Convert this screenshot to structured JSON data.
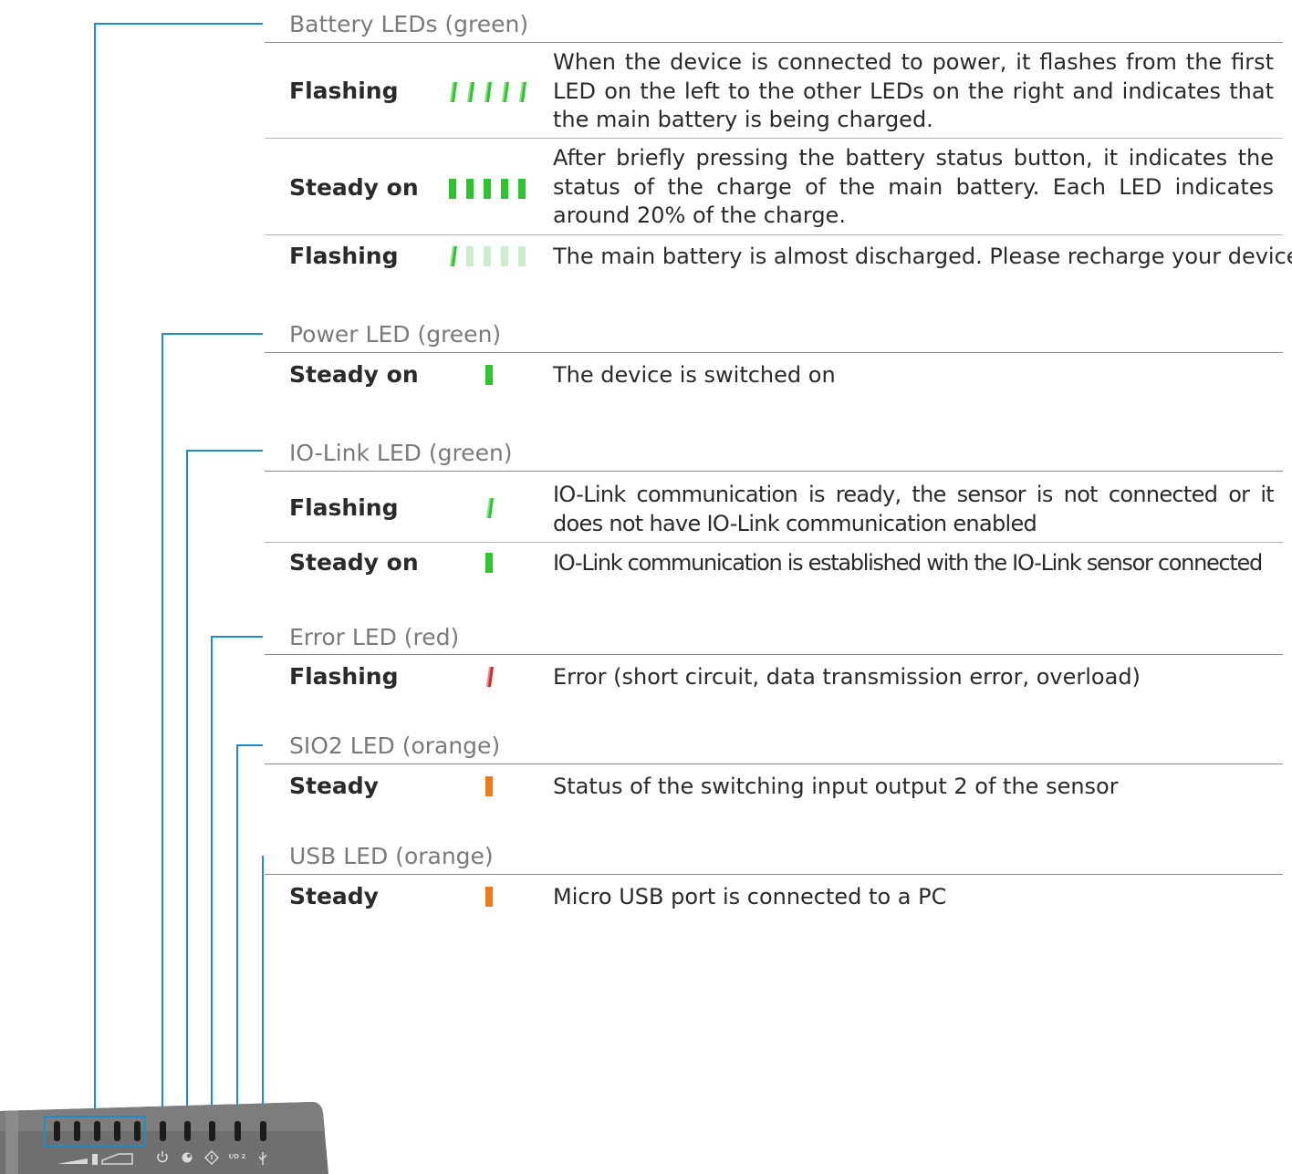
{
  "colors": {
    "connector": "#1a8fd0",
    "led_green": "#2cc62c",
    "led_green_dim": "#c9eec9",
    "led_red": "#d8282a",
    "led_orange": "#f07a1a",
    "device_body": "#6f6f6f",
    "device_dark": "#1c1c1c"
  },
  "sections": [
    {
      "title": "Battery LEDs (green)",
      "rows": [
        {
          "state": "Flashing",
          "led": {
            "mode": "flashing",
            "count": 5,
            "lit": 5,
            "color": "green"
          },
          "description": "When the device is connected to power, it flashes from the first LED on the left to the other LEDs on the right and indicates that the main battery is being charged."
        },
        {
          "state": "Steady on",
          "led": {
            "mode": "steady",
            "count": 5,
            "lit": 5,
            "color": "green"
          },
          "description": "After briefly pressing the battery status button, it indicates the status of the charge of the main battery. Each LED indicates around 20% of the charge."
        },
        {
          "state": "Flashing",
          "led": {
            "mode": "flashing",
            "count": 5,
            "lit": 1,
            "color": "green"
          },
          "description": "The main battery is almost discharged. Please recharge your device"
        }
      ]
    },
    {
      "title": "Power LED (green)",
      "rows": [
        {
          "state": "Steady on",
          "led": {
            "mode": "steady",
            "count": 1,
            "lit": 1,
            "color": "green"
          },
          "description": "The device is switched on"
        }
      ]
    },
    {
      "title": "IO-Link LED (green)",
      "rows": [
        {
          "state": "Flashing",
          "led": {
            "mode": "flashing",
            "count": 1,
            "lit": 1,
            "color": "green"
          },
          "description": "IO-Link communication is ready, the sensor is not connected or it does not have IO-Link communication enabled"
        },
        {
          "state": "Steady on",
          "led": {
            "mode": "steady",
            "count": 1,
            "lit": 1,
            "color": "green"
          },
          "description": "IO-Link communication is established with the IO-Link sensor connected"
        }
      ]
    },
    {
      "title": "Error LED (red)",
      "rows": [
        {
          "state": "Flashing",
          "led": {
            "mode": "flashing",
            "count": 1,
            "lit": 1,
            "color": "red"
          },
          "description": "Error (short circuit, data transmission error, overload)"
        }
      ]
    },
    {
      "title": "SIO2 LED (orange)",
      "rows": [
        {
          "state": "Steady",
          "led": {
            "mode": "steady",
            "count": 1,
            "lit": 1,
            "color": "orange"
          },
          "description": "Status of the switching input output 2 of the sensor"
        }
      ]
    },
    {
      "title": "USB LED (orange)",
      "rows": [
        {
          "state": "Steady",
          "led": {
            "mode": "steady",
            "count": 1,
            "lit": 1,
            "color": "orange"
          },
          "description": "Micro USB port is connected to a PC"
        }
      ]
    }
  ],
  "device": {
    "icons": [
      "battery-level-icon",
      "power-icon",
      "io-link-icon",
      "error-icon",
      "sio2-icon",
      "usb-icon"
    ],
    "sio2_icon_text": "I/O 2"
  }
}
